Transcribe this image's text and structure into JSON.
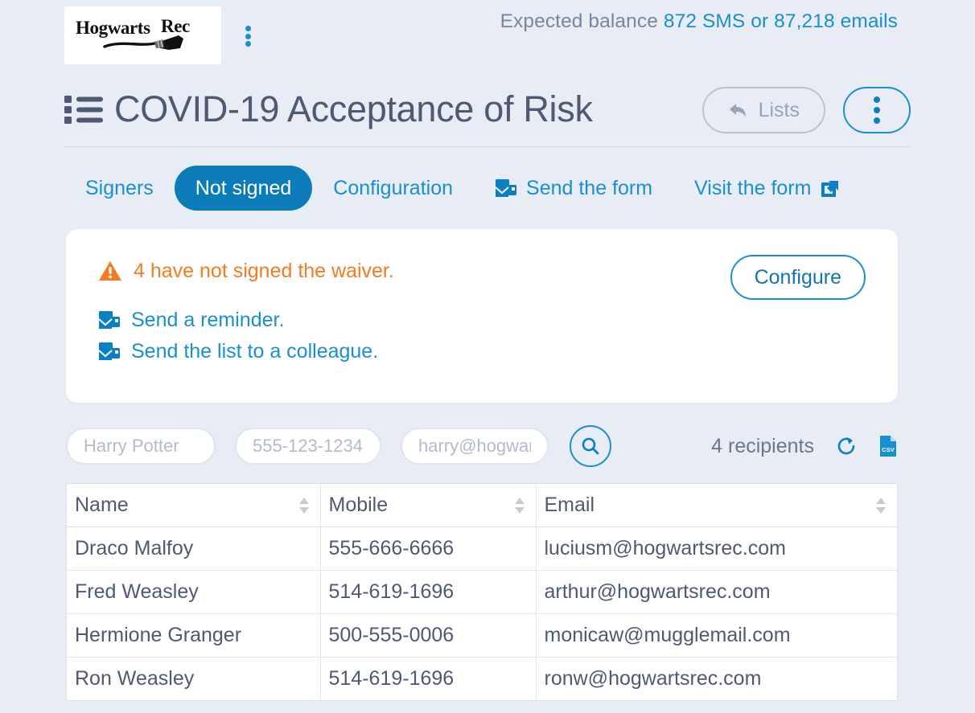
{
  "topbar": {
    "logo_text": "Hogwarts Rec",
    "logo_icon": "broomstick-icon",
    "kebab_icon": "kebab-menu-icon",
    "balance_label": "Expected balance ",
    "balance_value": "872 SMS or 87,218 emails"
  },
  "header": {
    "list_icon": "list-icon",
    "title": "COVID-19 Acceptance of Risk",
    "lists_button": "Lists",
    "lists_icon": "back-arrow-icon",
    "kebab_button_icon": "kebab-menu-icon"
  },
  "tabs": [
    {
      "label": "Signers",
      "active": false,
      "icon": null
    },
    {
      "label": "Not signed",
      "active": true,
      "icon": null
    },
    {
      "label": "Configuration",
      "active": false,
      "icon": null
    },
    {
      "label": "Send the form",
      "active": false,
      "icon": "send-form-icon"
    },
    {
      "label": "Visit the form",
      "active": false,
      "icon": "external-link-icon"
    }
  ],
  "alert": {
    "warning_icon": "warning-triangle-icon",
    "message": "4 have not signed the waiver.",
    "links": [
      {
        "label": "Send a reminder.",
        "icon": "send-form-icon"
      },
      {
        "label": "Send the list to a colleague.",
        "icon": "send-form-icon"
      }
    ],
    "configure_button": "Configure"
  },
  "filters": {
    "name_placeholder": "Harry Potter",
    "name_value": "",
    "mobile_placeholder": "555-123-1234",
    "mobile_value": "",
    "email_placeholder": "harry@hogwarts",
    "email_value": "",
    "search_icon": "search-icon",
    "recipients_count": "4 recipients",
    "refresh_icon": "refresh-icon",
    "export_icon": "csv-file-icon"
  },
  "table": {
    "columns": [
      {
        "label": "Name",
        "sort_icon": "sort-arrows-icon"
      },
      {
        "label": "Mobile",
        "sort_icon": "sort-arrows-icon"
      },
      {
        "label": "Email",
        "sort_icon": "sort-arrows-icon"
      }
    ],
    "rows": [
      {
        "name": "Draco Malfoy",
        "mobile": "555-666-6666",
        "email": "luciusm@hogwartsrec.com"
      },
      {
        "name": "Fred Weasley",
        "mobile": "514-619-1696",
        "email": "arthur@hogwartsrec.com"
      },
      {
        "name": "Hermione Granger",
        "mobile": "500-555-0006",
        "email": "monicaw@mugglemail.com"
      },
      {
        "name": "Ron Weasley",
        "mobile": "514-619-1696",
        "email": "ronw@hogwartsrec.com"
      }
    ]
  },
  "colors": {
    "page_background": "#e7ecf5",
    "accent_blue": "#1a8fd0",
    "active_tab_blue": "#0c7cb8",
    "warning_orange": "#f47b20",
    "text_slate": "#4e5a72",
    "muted_gray": "#9aa4b6"
  }
}
